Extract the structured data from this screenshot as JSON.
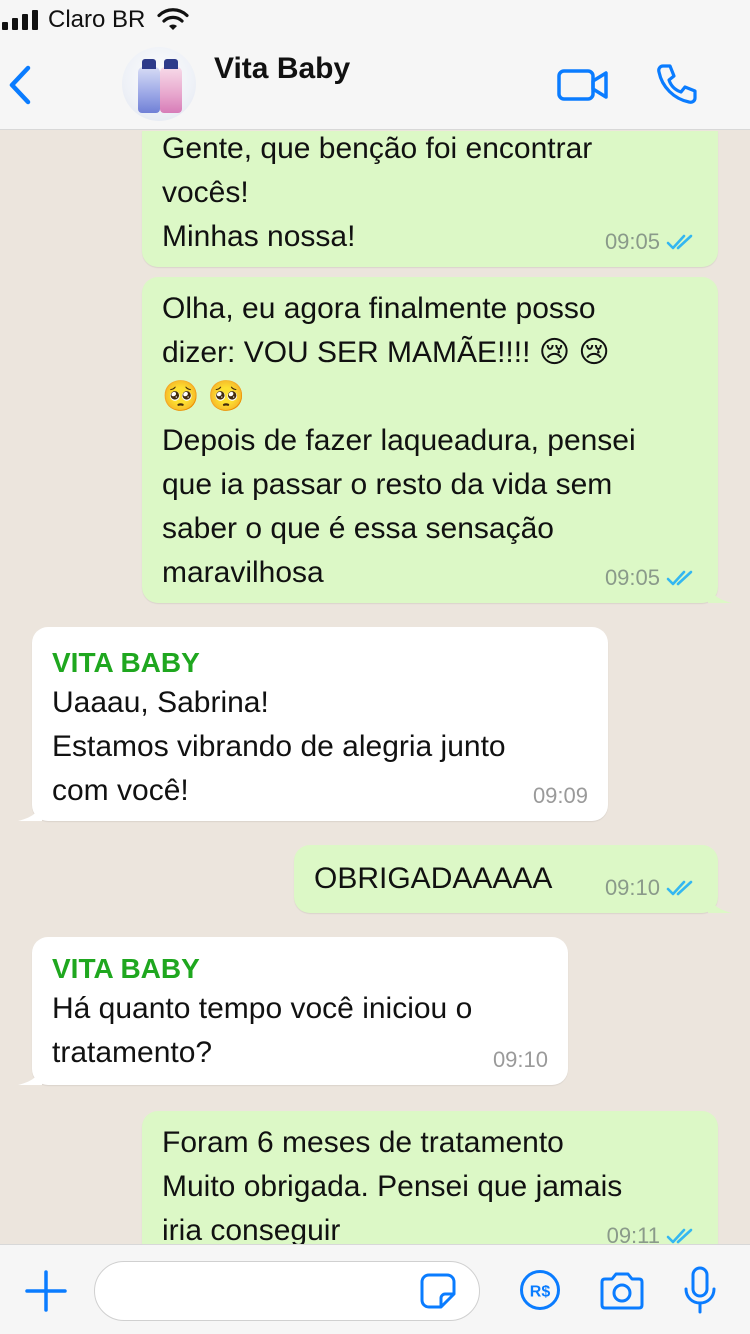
{
  "status_bar": {
    "carrier": "Claro BR"
  },
  "header": {
    "contact_name": "Vita Baby",
    "icons": [
      "chevron-left-icon",
      "video-camera-icon",
      "phone-icon"
    ]
  },
  "chat": {
    "messages": [
      {
        "direction": "out",
        "sender": "",
        "text": "Gente, que benção foi encontrar\nvocês!\nMinhas nossa!",
        "time": "09:05",
        "read": true
      },
      {
        "direction": "out",
        "sender": "",
        "text": "Olha, eu agora finalmente posso\ndizer: VOU SER MAMÃE!!!! 😢 😢\n🥺 🥺\nDepois de fazer laqueadura, pensei\nque ia passar o resto da vida sem\nsaber o que é essa sensação\nmaravilhosa",
        "time": "09:05",
        "read": true
      },
      {
        "direction": "in",
        "sender": "VITA BABY",
        "text": "Uaaau, Sabrina!\nEstamos vibrando de alegria junto\ncom você!",
        "time": "09:09",
        "read": false
      },
      {
        "direction": "out",
        "sender": "",
        "text": "OBRIGADAAAAA",
        "time": "09:10",
        "read": true
      },
      {
        "direction": "in",
        "sender": "VITA BABY",
        "text": "Há quanto tempo você iniciou o\ntratamento?",
        "time": "09:10",
        "read": false
      },
      {
        "direction": "out",
        "sender": "",
        "text": "Foram 6 meses de tratamento\nMuito obrigada. Pensei que jamais\niria conseguir",
        "time": "09:11",
        "read": true
      }
    ]
  },
  "input_bar": {
    "message_value": "",
    "icons": [
      "plus-icon",
      "sticker-icon",
      "payment-icon",
      "camera-icon",
      "microphone-icon"
    ]
  },
  "colors": {
    "accent": "#0a7cff",
    "outgoing_bubble": "#dcf8c6",
    "incoming_bubble": "#ffffff",
    "sender_name": "#1fa71f",
    "read_ticks": "#34b7f1",
    "chat_background": "#ece5dd"
  }
}
